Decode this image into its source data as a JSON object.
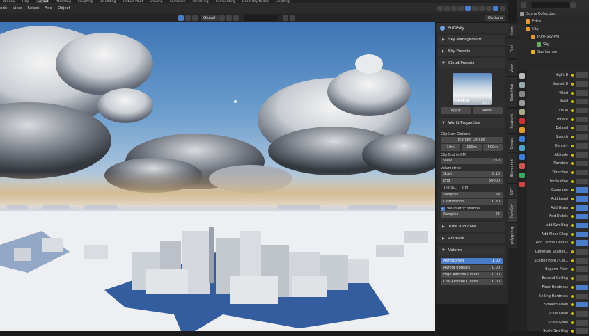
{
  "topbar": {
    "workspaces": [
      "Layout",
      "Modeling",
      "Sculpting",
      "UV Editing",
      "Texture Paint",
      "Shading",
      "Animation",
      "Rendering",
      "Compositing",
      "Geometry Nodes",
      "Scripting"
    ],
    "active": "Layout",
    "file_menu": [
      "Window",
      "Help"
    ]
  },
  "header": {
    "menus": [
      "ode",
      "View",
      "Select",
      "Add",
      "Object"
    ],
    "transform_orientation": "Global",
    "options_label": "Options"
  },
  "npanel": {
    "title": "PureSky",
    "sections": {
      "sky_management": "Sky Management",
      "sky_presets": "Sky Presets",
      "cloud_presets": "Cloud Presets",
      "world_properties": "World Properties",
      "time_and_date": "Time and date",
      "animate": "Animate",
      "volume": "Volume"
    },
    "cloud_preview": {
      "label": "CUMULUS",
      "number": "#001"
    },
    "apply_label": "Apply",
    "reset_label": "Reset",
    "clipstart_label": "ClipStart Options",
    "clipstart_default": "Blender Default",
    "clip_buttons": [
      "10m",
      "100m",
      "500m"
    ],
    "clip_end_label": "Clip End in KM",
    "view_label": "View",
    "view_value": "250",
    "volumetrics_label": "Volumetrics",
    "start_label": "Start",
    "start_value": "0.10",
    "end_label": "End",
    "end_value": "50000",
    "tile_size_label": "Tile Si...",
    "tile_size_value": "2 m",
    "samples_label": "Samples",
    "samples_value": "24",
    "distribution_label": "Distribution",
    "distribution_value": "0.80",
    "vol_shadow_label": "Volumetric Shadow",
    "vol_shadow_samples_label": "Samples",
    "vol_shadow_samples_value": "64",
    "volume_rows": [
      {
        "label": "Atmosphere",
        "value": "1.00"
      },
      {
        "label": "Aurora Borealis",
        "value": "0.00"
      },
      {
        "label": "High Altitude Clouds",
        "value": "0.00"
      },
      {
        "label": "Low Altitude Clouds",
        "value": "0.00"
      }
    ]
  },
  "vtabs": [
    "Item",
    "Tool",
    "View",
    "Sketchfab",
    "Scatter5",
    "Create",
    "Blenderkit",
    "CDT",
    "PureSky",
    "polygoniq"
  ],
  "outliner": {
    "rows": [
      "Scene Collection",
      "Extra",
      "City",
      "Pure-Sky Pro",
      "Sky",
      "Sun Lampe"
    ]
  },
  "properties": {
    "rows": [
      "Night B",
      "Sunset B",
      "Wind",
      "Weld",
      "Fill in",
      "Inflate",
      "Extend",
      "Stretch",
      "Density",
      "Altitude",
      "Random",
      "Direction",
      "Inclination",
      "Coverage",
      "Add Level",
      "Add Grain",
      "Add Debris",
      "Add Swelling",
      "Add Floor Chop",
      "Add Debris Details",
      "Generate Scatter...",
      "Scatter Hole / Col...",
      "Expand Floor",
      "Expand Ceiling",
      "Floor Hardness",
      "Ceiling Hardness",
      "Smooth Level",
      "Scale Level",
      "Scale Grain",
      "Scale Swelling"
    ]
  }
}
